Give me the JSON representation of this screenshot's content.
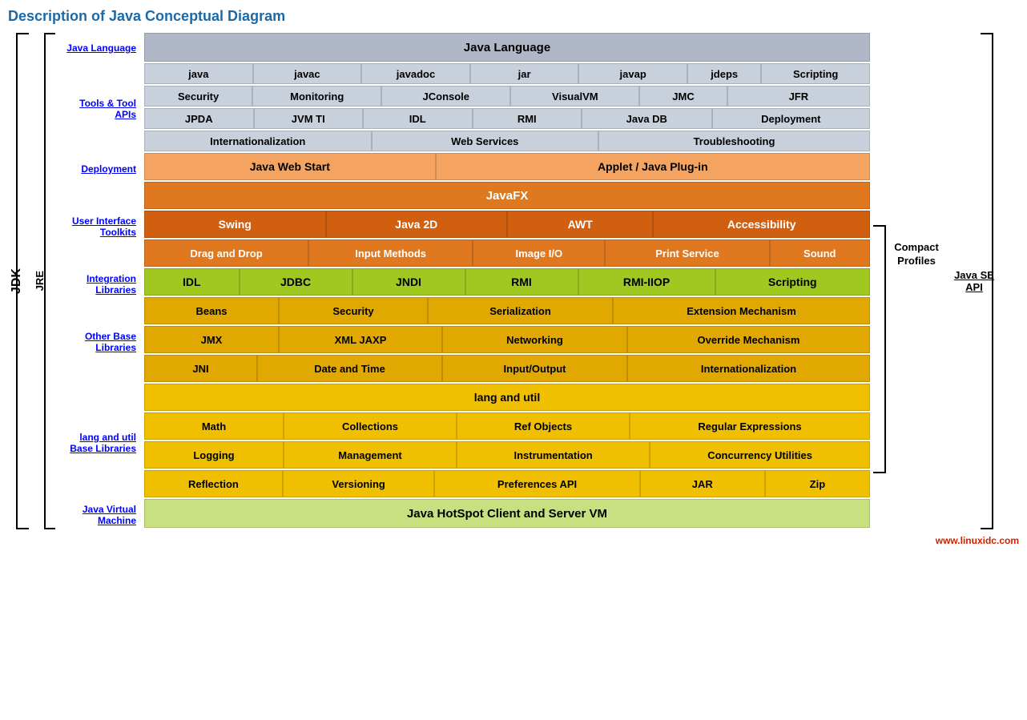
{
  "title": "Description of Java Conceptual Diagram",
  "labels": {
    "java_language": "Java Language",
    "tools": "Tools & Tool APIs",
    "deployment": "Deployment",
    "user_interface": "User Interface Toolkits",
    "integration": "Integration Libraries",
    "other_base": "Other Base Libraries",
    "lang_util": "lang and util Base Libraries",
    "jvm": "Java Virtual Machine",
    "jdk": "JDK",
    "jre": "JRE",
    "compact_profiles": "Compact Profiles",
    "java_se_api": "Java SE API"
  },
  "rows": {
    "java_language_header": "Java Language",
    "tools_row1": [
      "java",
      "javac",
      "javadoc",
      "jar",
      "javap",
      "jdeps",
      "Scripting"
    ],
    "tools_row2": [
      "Security",
      "Monitoring",
      "JConsole",
      "VisualVM",
      "JMC",
      "JFR"
    ],
    "tools_row3": [
      "JPDA",
      "JVM TI",
      "IDL",
      "RMI",
      "Java DB",
      "Deployment"
    ],
    "tools_row4": [
      "Internationalization",
      "Web Services",
      "Troubleshooting"
    ],
    "deployment_row": [
      "Java Web Start",
      "Applet / Java Plug-in"
    ],
    "javafx_row": "JavaFX",
    "ui_row1": [
      "Swing",
      "Java 2D",
      "AWT",
      "Accessibility"
    ],
    "ui_row2": [
      "Drag and Drop",
      "Input Methods",
      "Image I/O",
      "Print Service",
      "Sound"
    ],
    "integration_row": [
      "IDL",
      "JDBC",
      "JNDI",
      "RMI",
      "RMI-IIOP",
      "Scripting"
    ],
    "other_row1": [
      "Beans",
      "Security",
      "Serialization",
      "Extension Mechanism"
    ],
    "other_row2": [
      "JMX",
      "XML JAXP",
      "Networking",
      "Override Mechanism"
    ],
    "other_row3": [
      "JNI",
      "Date and Time",
      "Input/Output",
      "Internationalization"
    ],
    "lang_header": "lang and util",
    "lang_row1": [
      "Math",
      "Collections",
      "Ref Objects",
      "Regular Expressions"
    ],
    "lang_row2": [
      "Logging",
      "Management",
      "Instrumentation",
      "Concurrency Utilities"
    ],
    "lang_row3": [
      "Reflection",
      "Versioning",
      "Preferences API",
      "JAR",
      "Zip"
    ],
    "jvm_row": "Java HotSpot Client and Server VM"
  },
  "watermark": "www.linuxidc.com"
}
